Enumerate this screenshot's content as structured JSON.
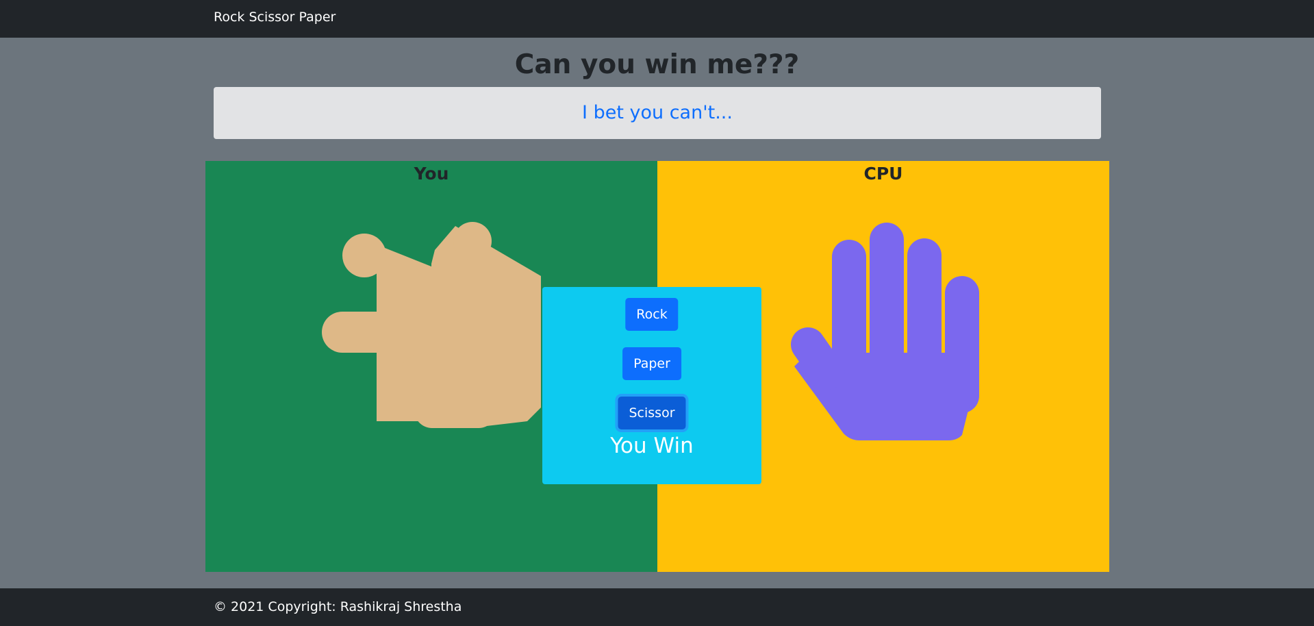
{
  "navbar": {
    "brand": "Rock Scissor Paper"
  },
  "header": {
    "title": "Can you win me???",
    "tagline": "I bet you can't..."
  },
  "player": {
    "label": "You",
    "choice": "scissor",
    "hand_color": "#deb887",
    "panel_color": "#198754"
  },
  "cpu": {
    "label": "CPU",
    "choice": "paper",
    "hand_color": "#7b68ee",
    "panel_color": "#ffc107"
  },
  "controls": {
    "rock_label": "Rock",
    "paper_label": "Paper",
    "scissor_label": "Scissor",
    "selected": "scissor",
    "button_color": "#0d6efd",
    "box_color": "#0dcaf0"
  },
  "result": "You Win",
  "footer": {
    "copyright": "© 2021 Copyright: Rashikraj Shrestha"
  }
}
